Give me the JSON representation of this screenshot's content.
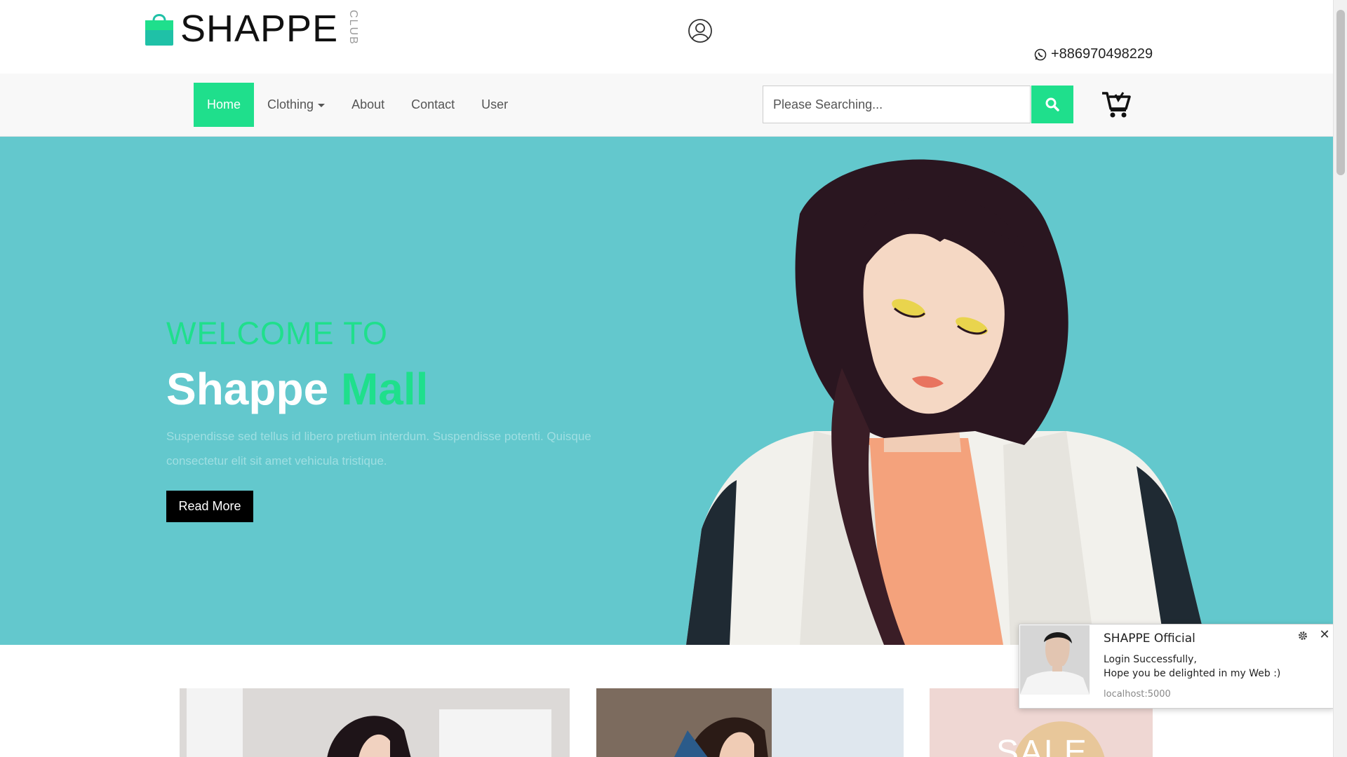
{
  "brand": {
    "name": "SHAPPE",
    "tag": "CLUB"
  },
  "contact": {
    "phone": "+886970498229"
  },
  "nav": {
    "items": [
      {
        "label": "Home",
        "active": true
      },
      {
        "label": "Clothing"
      },
      {
        "label": "About"
      },
      {
        "label": "Contact"
      },
      {
        "label": "User"
      }
    ]
  },
  "search": {
    "placeholder": "Please Searching..."
  },
  "hero": {
    "subtitle": "WELCOME TO",
    "title_main": "Shappe",
    "title_accent": "Mall",
    "text": "Suspendisse sed tellus id libero pretium interdum. Suspendisse potenti. Quisque consectetur elit sit amet vehicula tristique.",
    "button": "Read More"
  },
  "promo": {
    "sale_text": "SALE"
  },
  "notification": {
    "title": "SHAPPE Official",
    "line1": "Login Successfully,",
    "line2": "Hope you be delighted in my Web :)",
    "source": "localhost:5000"
  },
  "colors": {
    "accent": "#1fdf8c",
    "hero_bg": "#63c8cd",
    "dark": "#000000"
  },
  "icons": [
    "shopping-bag-icon",
    "user-circle-icon",
    "whatsapp-icon",
    "caret-down-icon",
    "search-icon",
    "cart-icon",
    "gear-icon",
    "close-icon"
  ]
}
